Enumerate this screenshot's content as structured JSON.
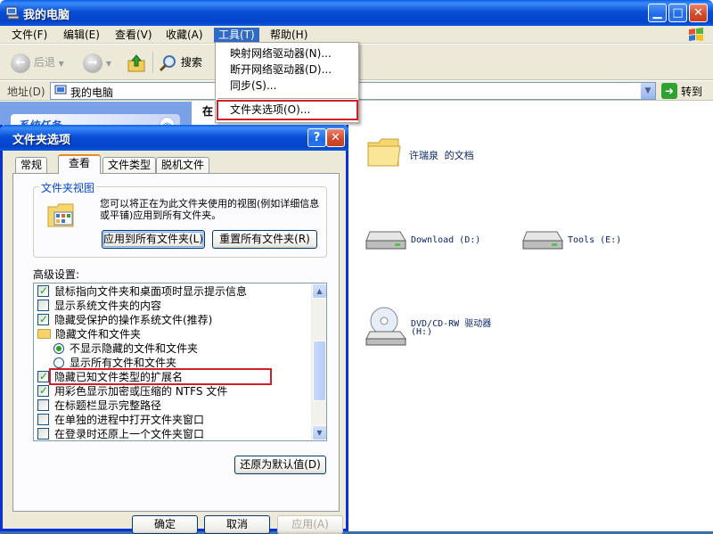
{
  "explorer": {
    "title": "我的电脑",
    "menu": [
      "文件(F)",
      "编辑(E)",
      "查看(V)",
      "收藏(A)",
      "工具(T)",
      "帮助(H)"
    ],
    "toolbar": {
      "back": "后退",
      "search": "搜索"
    },
    "address": {
      "label": "地址(D)",
      "value": "我的电脑",
      "go": "转到"
    },
    "tasks_header": "系统任务",
    "content_header": "在",
    "items": {
      "my_docs": "许瑞泉 的文档",
      "download": "Download (D:)",
      "tools": "Tools (E:)",
      "dvd_line1": "DVD/CD-RW 驱动器",
      "dvd_line2": "(H:)"
    }
  },
  "tools_menu": {
    "items": [
      "映射网络驱动器(N)...",
      "断开网络驱动器(D)...",
      "同步(S)...",
      "文件夹选项(O)..."
    ]
  },
  "dialog": {
    "title": "文件夹选项",
    "tabs": [
      "常规",
      "查看",
      "文件类型",
      "脱机文件"
    ],
    "active_tab": "查看",
    "group_caption": "文件夹视图",
    "group_desc": "您可以将正在为此文件夹使用的视图(例如详细信息或平铺)应用到所有文件夹。",
    "apply_all": "应用到所有文件夹(L)",
    "reset_all": "重置所有文件夹(R)",
    "advanced_label": "高级设置:",
    "settings": [
      {
        "type": "checkbox",
        "checked": true,
        "label": "鼠标指向文件夹和桌面项时显示提示信息"
      },
      {
        "type": "checkbox",
        "checked": false,
        "label": "显示系统文件夹的内容"
      },
      {
        "type": "checkbox",
        "checked": true,
        "label": "隐藏受保护的操作系统文件(推荐)"
      },
      {
        "type": "folder",
        "label": "隐藏文件和文件夹"
      },
      {
        "type": "radio",
        "checked": true,
        "label": "不显示隐藏的文件和文件夹"
      },
      {
        "type": "radio",
        "checked": false,
        "label": "显示所有文件和文件夹"
      },
      {
        "type": "checkbox",
        "checked": true,
        "label": "隐藏已知文件类型的扩展名"
      },
      {
        "type": "checkbox",
        "checked": true,
        "label": "用彩色显示加密或压缩的 NTFS 文件"
      },
      {
        "type": "checkbox",
        "checked": false,
        "label": "在标题栏显示完整路径"
      },
      {
        "type": "checkbox",
        "checked": false,
        "label": "在单独的进程中打开文件夹窗口"
      },
      {
        "type": "checkbox",
        "checked": false,
        "label": "在登录时还原上一个文件夹窗口"
      }
    ],
    "restore_defaults": "还原为默认值(D)",
    "ok": "确定",
    "cancel": "取消",
    "apply": "应用(A)"
  }
}
